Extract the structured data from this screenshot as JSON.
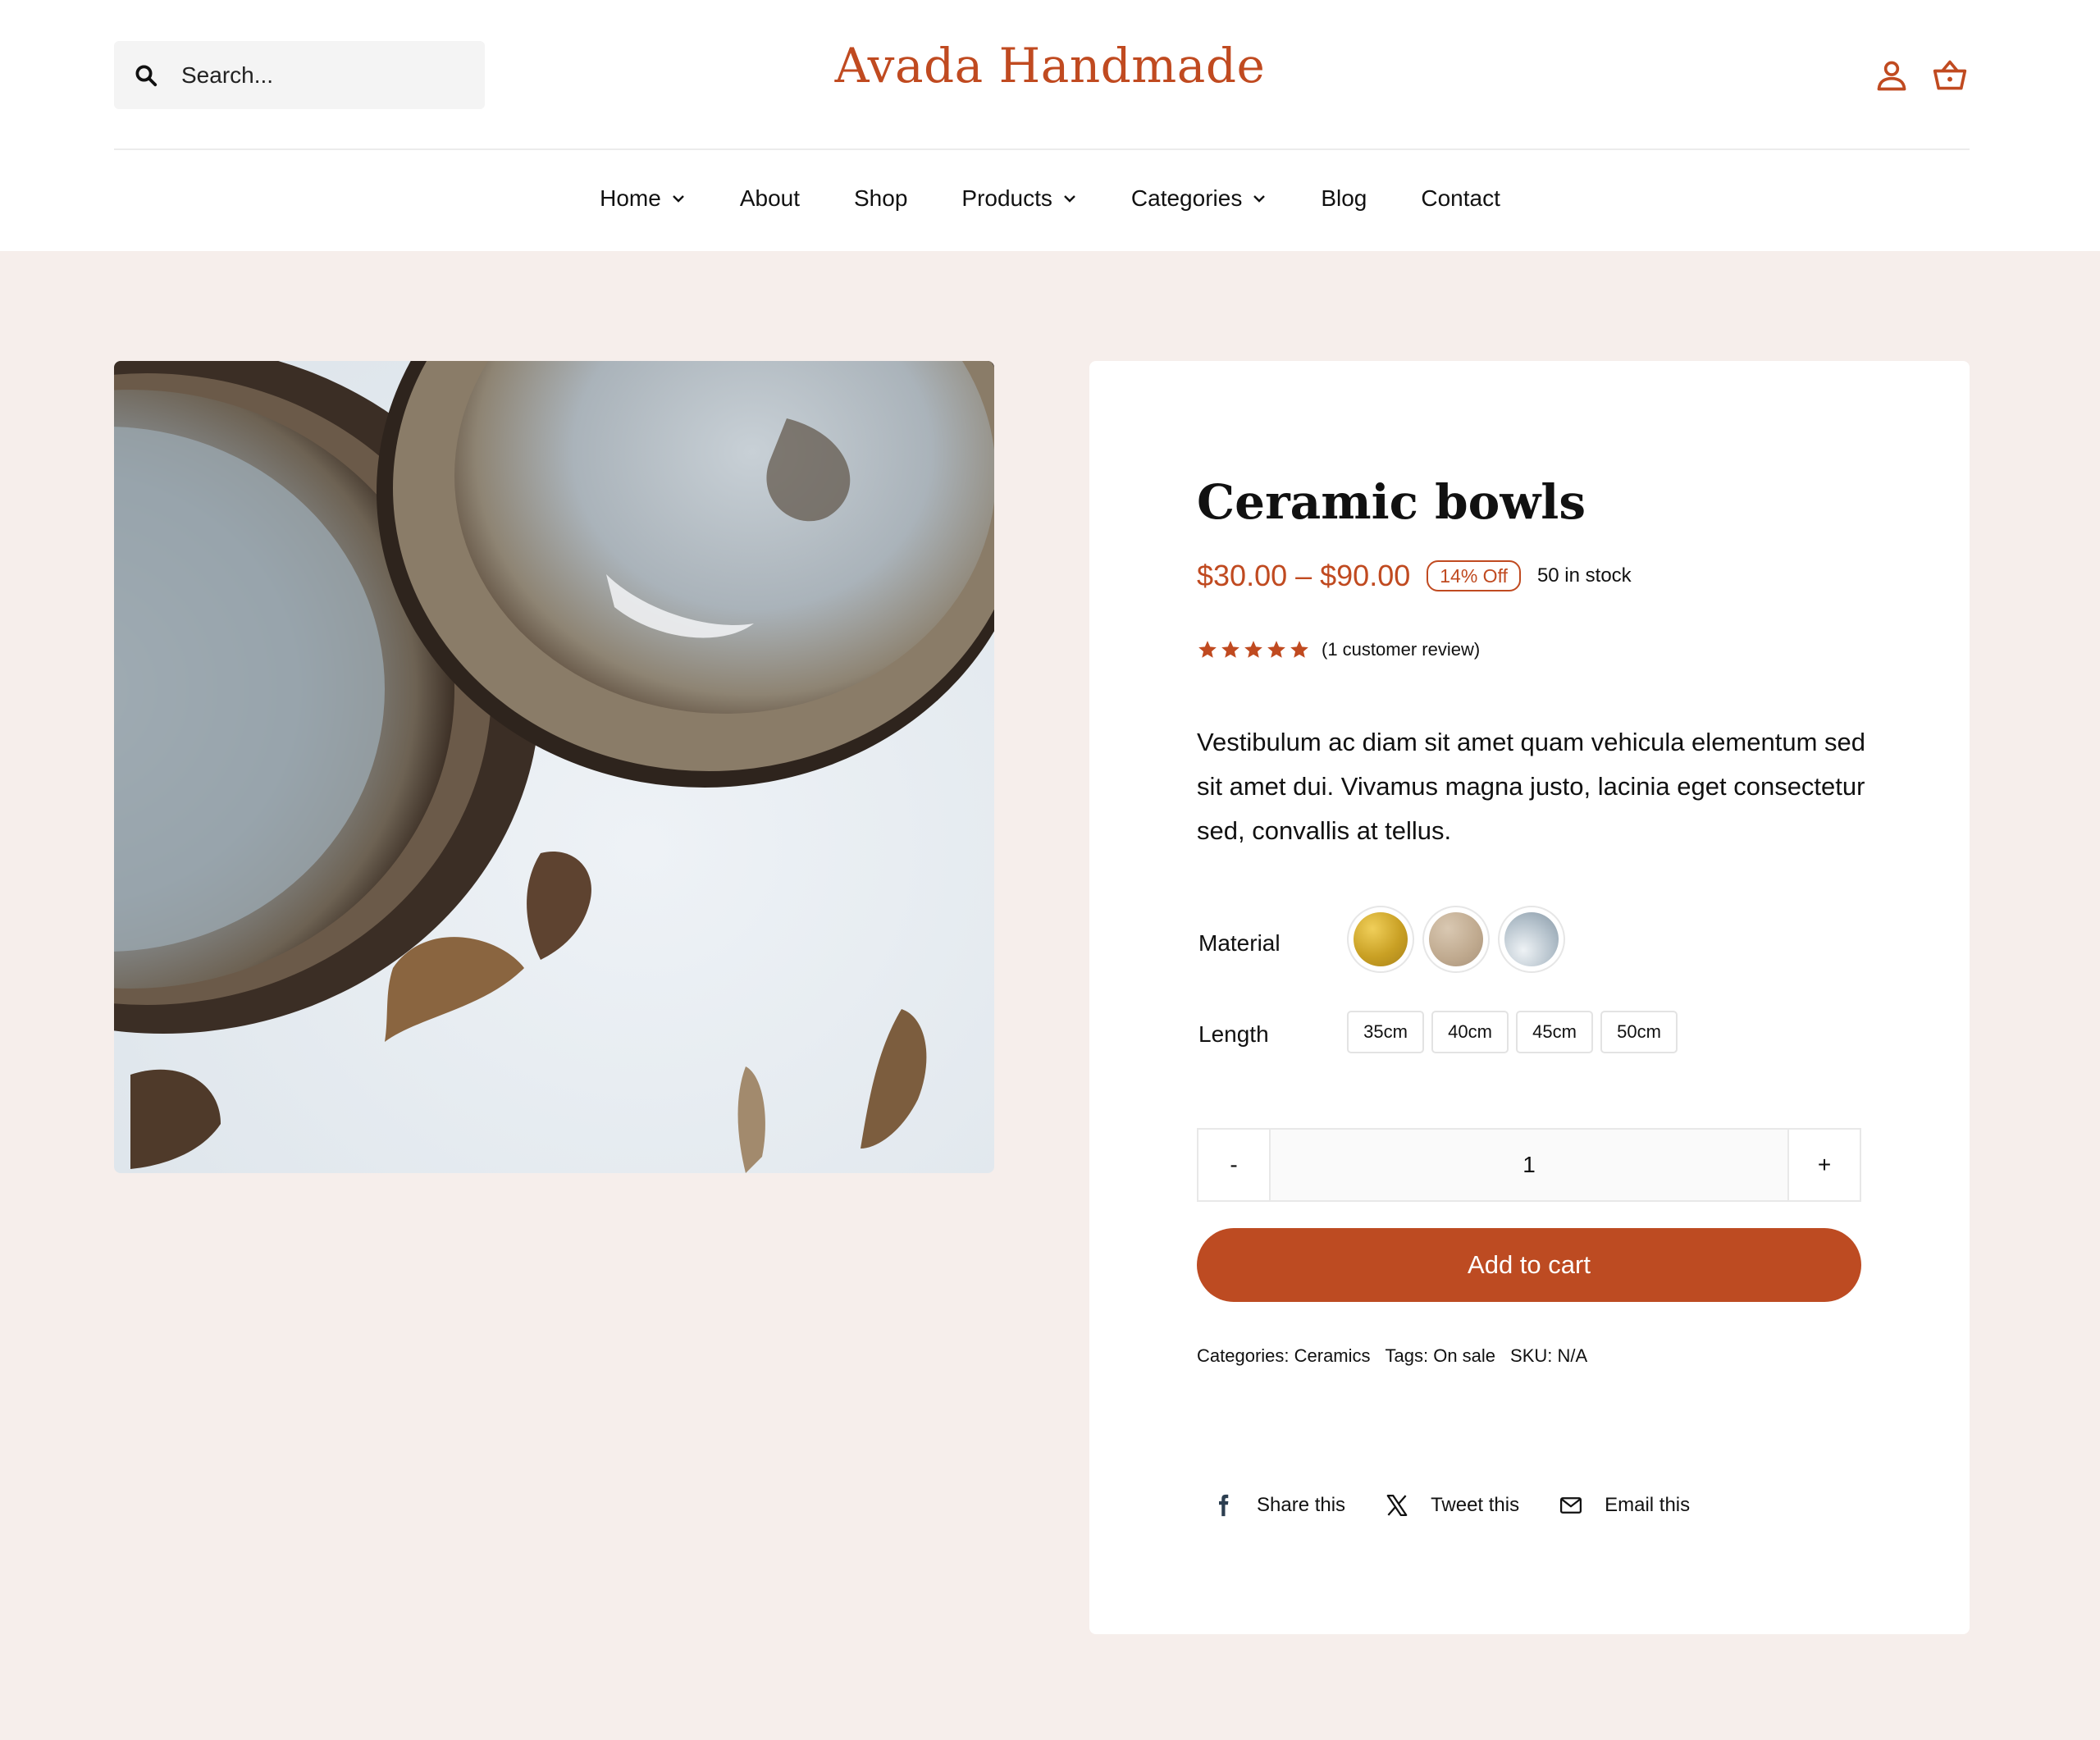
{
  "header": {
    "search_placeholder": "Search...",
    "logo": "Avada Handmade",
    "icons": {
      "account": "user-icon",
      "cart": "basket-icon",
      "search": "search-icon"
    }
  },
  "nav": {
    "items": [
      {
        "label": "Home",
        "has_dropdown": true
      },
      {
        "label": "About",
        "has_dropdown": false
      },
      {
        "label": "Shop",
        "has_dropdown": false
      },
      {
        "label": "Products",
        "has_dropdown": true
      },
      {
        "label": "Categories",
        "has_dropdown": true
      },
      {
        "label": "Blog",
        "has_dropdown": false
      },
      {
        "label": "Contact",
        "has_dropdown": false
      }
    ]
  },
  "product": {
    "title": "Ceramic bowls",
    "price": "$30.00 – $90.00",
    "discount_badge": "14% Off",
    "stock": "50 in stock",
    "rating": 5,
    "review_text": "(1 customer review)",
    "description": "Vestibulum ac diam sit amet quam vehicula elementum sed sit amet dui. Vivamus magna justo, lacinia eget consectetur sed, convallis at tellus.",
    "options": {
      "material_label": "Material",
      "materials": [
        "gold",
        "beige",
        "silver"
      ],
      "length_label": "Length",
      "lengths": [
        "35cm",
        "40cm",
        "45cm",
        "50cm"
      ]
    },
    "quantity": {
      "minus": "-",
      "value": "1",
      "plus": "+"
    },
    "add_to_cart": "Add to cart",
    "meta": {
      "categories": "Categories: Ceramics",
      "tags": "Tags: On sale",
      "sku": "SKU: N/A"
    },
    "share": {
      "facebook": "Share this",
      "twitter": "Tweet this",
      "email": "Email this"
    }
  },
  "colors": {
    "accent": "#c04a20",
    "button": "#bd4b22",
    "page_background": "#f6eeeb",
    "search_background": "#f4f4f4"
  }
}
